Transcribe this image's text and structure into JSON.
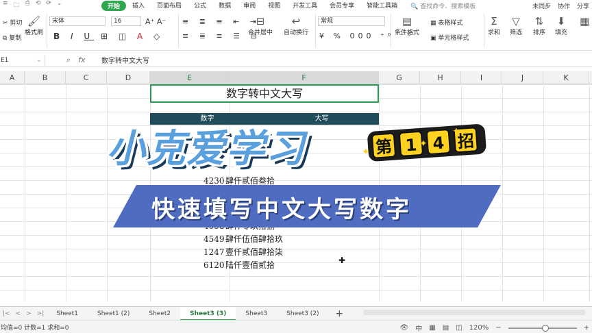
{
  "menubar": {
    "quick_icons": [
      "≡",
      "🗀",
      "⎙",
      "⟲",
      "⟳",
      "⌄"
    ],
    "items": [
      "开始",
      "插入",
      "页面布局",
      "公式",
      "数据",
      "审阅",
      "视图",
      "开发工具",
      "会员专享",
      "智能工具箱"
    ],
    "active_index": 0,
    "search": "查找命令、搜索模板",
    "right": [
      "未同步",
      "协作",
      "分享"
    ]
  },
  "ribbon": {
    "cut": "剪切",
    "copy": "复制",
    "format_painter": "格式刷",
    "font_name": "宋体",
    "font_size": "16",
    "merge_center": "合并居中",
    "wrap_text": "自动换行",
    "number_format": "常规",
    "table_style": "表格样式",
    "cell_style": "单元格样式",
    "cond_format": "条件格式",
    "sum": "求和",
    "filter": "筛选",
    "sort": "排序",
    "fill": "填充",
    "percent": "%",
    "thousands": "000"
  },
  "formula_bar": {
    "name_box": "E1",
    "fx": "fx",
    "content": "数字转中文大写"
  },
  "columns": [
    {
      "label": "A",
      "selected": false
    },
    {
      "label": "B",
      "selected": false
    },
    {
      "label": "C",
      "selected": false
    },
    {
      "label": "D",
      "selected": false
    },
    {
      "label": "E",
      "selected": true
    },
    {
      "label": "F",
      "selected": true
    },
    {
      "label": "G",
      "selected": false
    },
    {
      "label": "H",
      "selected": false
    },
    {
      "label": "I",
      "selected": false
    },
    {
      "label": "J",
      "selected": false
    },
    {
      "label": "K",
      "selected": false
    }
  ],
  "sheet": {
    "title": "数字转中文大写",
    "header_left": "数字",
    "header_right": "大写",
    "rows": [
      {
        "num": "4230",
        "text": "肆仟贰佰叁拾"
      },
      {
        "num": "4098",
        "text": "肆仟零玖拾捌"
      },
      {
        "num": "4549",
        "text": "肆仟伍佰肆拾玖"
      },
      {
        "num": "1247",
        "text": "壹仟贰佰肆拾柒"
      },
      {
        "num": "6120",
        "text": "陆仟壹佰贰拾"
      }
    ]
  },
  "overlay": {
    "title": "小克爱学习",
    "badge_chars": [
      "第",
      "1",
      "4",
      "招"
    ],
    "banner": "快速填写中文大写数字",
    "banner_color": "#4f6cc0"
  },
  "tabs": {
    "items": [
      "Sheet1",
      "Sheet1 (2)",
      "Sheet2",
      "Sheet3 (3)",
      "Sheet3",
      "Sheet3 (2)"
    ],
    "active_index": 3,
    "add": "+"
  },
  "status": {
    "left": "均值=0  计数=1  求和=0",
    "zoom": "120%",
    "zoom_level_fraction": 0.55
  },
  "colors": {
    "accent_green": "#2ea84e",
    "header_dark": "#1f4e5a",
    "title_blue": "#5aa0dc",
    "badge_yellow": "#ffd21f"
  }
}
